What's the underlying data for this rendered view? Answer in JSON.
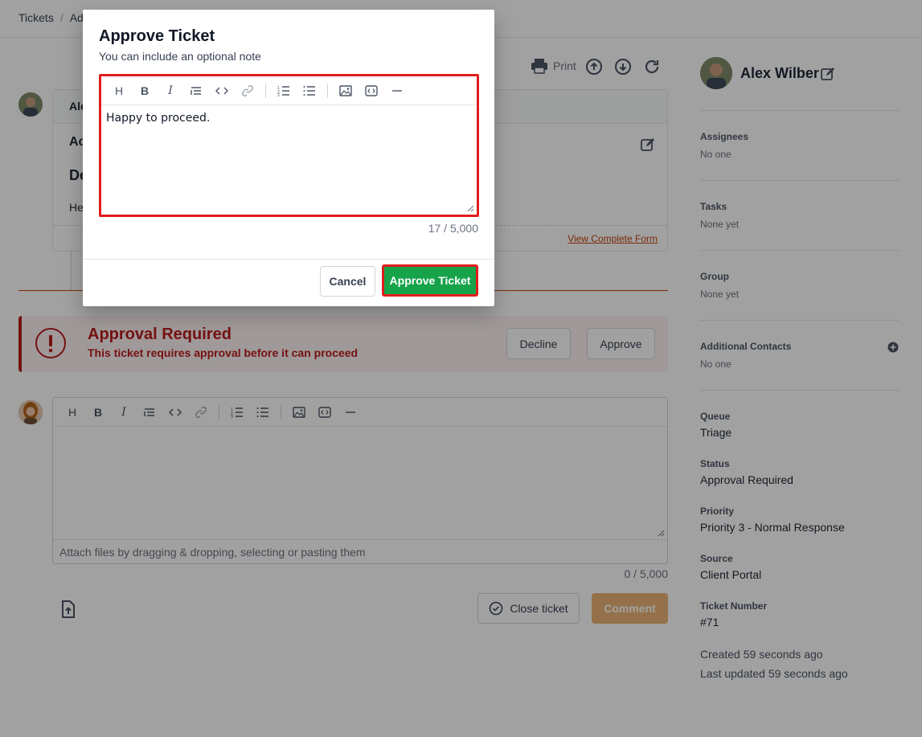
{
  "breadcrumb": {
    "root": "Tickets",
    "separator": "/",
    "current": "Ad"
  },
  "header": {
    "print_label": "Print"
  },
  "thread": {
    "author_partial": "Ale",
    "line1_partial": "Ac",
    "heading_partial": "De",
    "body_partial": "He",
    "view_form_link": "View Complete Form"
  },
  "approval": {
    "title": "Approval Required",
    "message": "This ticket requires approval before it can proceed",
    "decline_label": "Decline",
    "approve_label": "Approve"
  },
  "comment": {
    "attach_hint": "Attach files by dragging & dropping, selecting or pasting them",
    "counter": "0 / 5,000",
    "close_ticket_label": "Close ticket",
    "comment_label": "Comment"
  },
  "sidebar": {
    "name": "Alex Wilber",
    "assignees_label": "Assignees",
    "assignees_value": "No one",
    "tasks_label": "Tasks",
    "tasks_value": "None yet",
    "group_label": "Group",
    "group_value": "None yet",
    "contacts_label": "Additional Contacts",
    "contacts_value": "No one",
    "queue_label": "Queue",
    "queue_value": "Triage",
    "status_label": "Status",
    "status_value": "Approval Required",
    "priority_label": "Priority",
    "priority_value": "Priority 3 - Normal Response",
    "source_label": "Source",
    "source_value": "Client Portal",
    "ticket_number_label": "Ticket Number",
    "ticket_number_value": "#71",
    "created": "Created 59 seconds ago",
    "updated": "Last updated 59 seconds ago"
  },
  "modal": {
    "title": "Approve Ticket",
    "subtitle": "You can include an optional note",
    "note_text": "Happy to proceed.",
    "counter": "17 / 5,000",
    "cancel_label": "Cancel",
    "approve_label": "Approve Ticket"
  },
  "colors": {
    "accent": "#c2410c",
    "approve_green": "#16a34a",
    "danger": "#b91c1c",
    "highlight": "#e11d1d"
  }
}
